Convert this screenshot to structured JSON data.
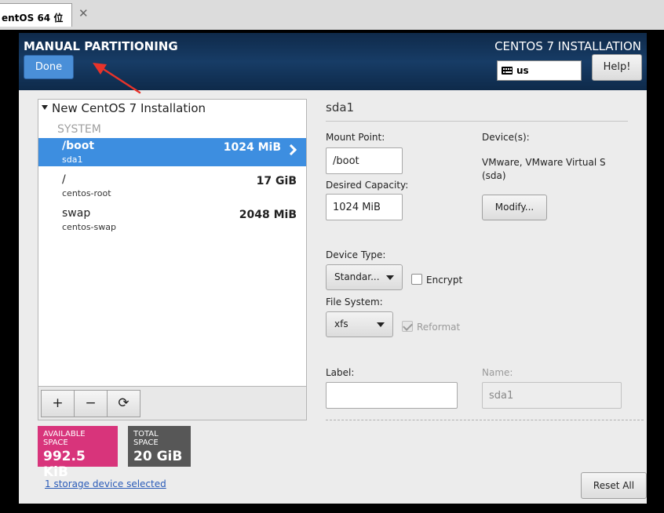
{
  "vm": {
    "tab_label": "entOS 64 位",
    "close_symbol": "✕"
  },
  "header": {
    "title": "MANUAL PARTITIONING",
    "done_label": "Done",
    "product": "CENTOS 7 INSTALLATION",
    "keyboard_layout": "us",
    "help_label": "Help!",
    "bg_color": "#173c66",
    "done_color": "#4a8fd8"
  },
  "partitions": {
    "group_name": "New CentOS 7 Installation",
    "section": "SYSTEM",
    "items": [
      {
        "mount": "/boot",
        "device": "sda1",
        "size": "1024 MiB",
        "selected": true
      },
      {
        "mount": "/",
        "device": "centos-root",
        "size": "17 GiB",
        "selected": false
      },
      {
        "mount": "swap",
        "device": "centos-swap",
        "size": "2048 MiB",
        "selected": false
      }
    ],
    "selected_color": "#3d8ee0"
  },
  "toolbar": {
    "add_symbol": "+",
    "remove_symbol": "−",
    "refresh_symbol": "⟳"
  },
  "space": {
    "available_label": "AVAILABLE SPACE",
    "available_value": "992.5 KiB",
    "total_label": "TOTAL SPACE",
    "total_value": "20 GiB",
    "available_color": "#d8347b",
    "total_color": "#575757"
  },
  "storage_link": "1 storage device selected",
  "detail": {
    "title": "sda1",
    "mount_point_label": "Mount Point:",
    "mount_point_value": "/boot",
    "capacity_label": "Desired Capacity:",
    "capacity_value": "1024 MiB",
    "devices_label": "Device(s):",
    "devices_line1": "VMware, VMware Virtual S",
    "devices_line2": "(sda)",
    "modify_label": "Modify...",
    "device_type_label": "Device Type:",
    "device_type_value": "Standar...",
    "encrypt_label": "Encrypt",
    "filesystem_label": "File System:",
    "filesystem_value": "xfs",
    "reformat_label": "Reformat",
    "label_label": "Label:",
    "label_value": "",
    "name_label": "Name:",
    "name_value": "sda1",
    "reset_label": "Reset All"
  },
  "annotation": {
    "arrow_color": "#e8332a"
  }
}
